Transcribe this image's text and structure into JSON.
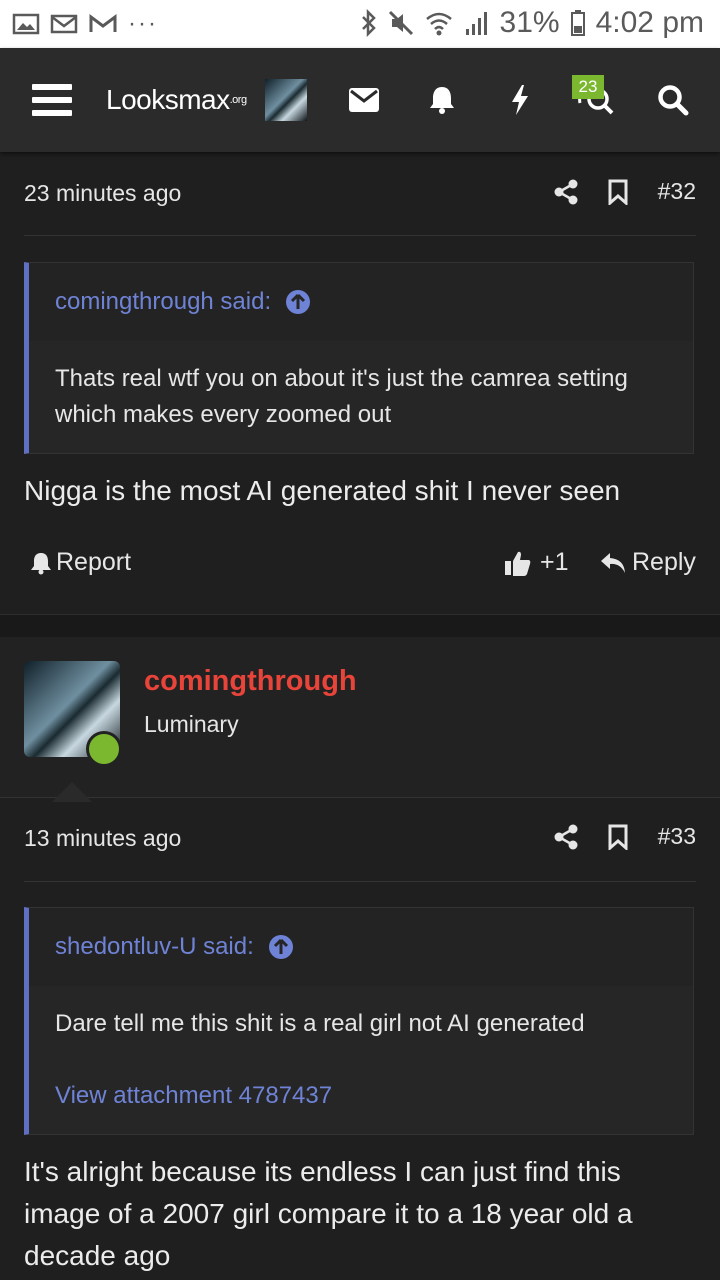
{
  "statusbar": {
    "battery": "31%",
    "time": "4:02 pm",
    "dots": "···"
  },
  "nav": {
    "logo_main": "Looksmax",
    "logo_suffix": ".org",
    "conversations_badge": "23"
  },
  "post32": {
    "time": "23 minutes ago",
    "number": "#32",
    "quote_author": "comingthrough said:",
    "quote_text": "Thats real wtf you on about it's just the camrea setting which makes every zoomed out",
    "text": "Nigga is the most AI generated shit I never seen",
    "report_label": "Report",
    "like_count": "+1",
    "reply_label": "Reply"
  },
  "user33": {
    "name": "comingthrough",
    "title": "Luminary"
  },
  "post33": {
    "time": "13 minutes ago",
    "number": "#33",
    "quote_author": "shedontluv-U said:",
    "quote_text": "Dare tell me this shit is a real girl not AI generated",
    "attachment_link": "View attachment 4787437",
    "text": "It's alright because its endless I can just find this image of a 2007 girl compare it to a 18 year old a decade ago"
  },
  "colors": {
    "accent_link": "#6f83d6",
    "username": "#e8443a",
    "online": "#7cb82f"
  }
}
